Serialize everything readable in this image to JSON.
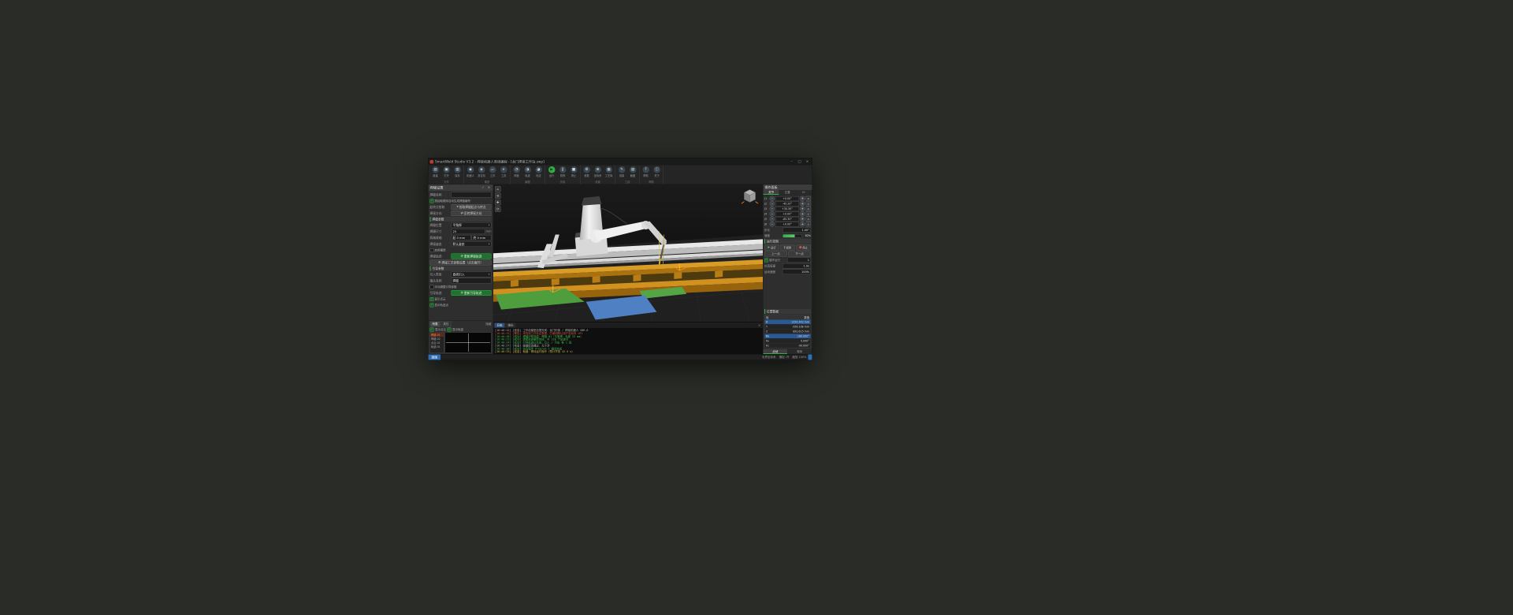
{
  "ui": {
    "chevron": "▾",
    "check": "✓"
  },
  "colors": {
    "accent_green": "#2fae44",
    "accent_blue": "#2f6fb3",
    "selection_orange": "#ff8a50",
    "log_green": "#43bf4f",
    "log_red": "#e0543f",
    "beam_orange": "#d99c26",
    "highlight_green": "#4f9e3e",
    "highlight_blue": "#5080c4",
    "table_select_blue": "#2a5a96"
  },
  "window": {
    "title": "SmartWeld Studio V3.2 - 焊接机器人离线编程 - [龙门焊接工作站.swp]",
    "minimize": "–",
    "maximize": "□",
    "close": "×"
  },
  "ribbon": {
    "groups": [
      {
        "name": "文件",
        "buttons": [
          {
            "icon": "▤",
            "label": "新建"
          },
          {
            "icon": "▣",
            "label": "打开"
          },
          {
            "icon": "▥",
            "label": "保存"
          }
        ]
      },
      {
        "name": "模型",
        "buttons": [
          {
            "icon": "◆",
            "label": "机器人"
          },
          {
            "icon": "◈",
            "label": "变位机"
          },
          {
            "icon": "▱",
            "label": "工件"
          },
          {
            "icon": "⌖",
            "label": "工具"
          }
        ]
      },
      {
        "name": "编程",
        "buttons": [
          {
            "icon": "◔",
            "label": "焊缝"
          },
          {
            "icon": "◑",
            "label": "轨迹"
          },
          {
            "icon": "◕",
            "label": "标定"
          }
        ]
      },
      {
        "name": "仿真",
        "buttons": [
          {
            "icon": "▶",
            "label": "运行",
            "style": "accent"
          },
          {
            "icon": "‖",
            "label": "暂停"
          },
          {
            "icon": "■",
            "label": "停止"
          }
        ]
      },
      {
        "name": "设置",
        "buttons": [
          {
            "icon": "⚙",
            "label": "参数"
          },
          {
            "icon": "⊞",
            "label": "坐标系"
          },
          {
            "icon": "▦",
            "label": "工艺库"
          }
        ]
      },
      {
        "name": "工具",
        "buttons": [
          {
            "icon": "✎",
            "label": "测量"
          },
          {
            "icon": "▧",
            "label": "截图"
          }
        ]
      },
      {
        "name": "帮助",
        "buttons": [
          {
            "icon": "?",
            "label": "帮助"
          },
          {
            "icon": "ⓘ",
            "label": "关于"
          }
        ]
      }
    ]
  },
  "left_panel": {
    "title": "焊缝设置",
    "confirm": "✓",
    "close": "×",
    "fields": {
      "name_label": "焊缝名称",
      "name_value": "",
      "auto_number": "按拾取顺序自动生成焊缝编号",
      "pick_label": "起终点拾取",
      "pick_icon": "⌖",
      "pick_button": "拾取焊缝起点与终点",
      "dir_label": "焊接方向",
      "dir_icon": "⇄",
      "dir_button": "反转焊接方向",
      "weld_section": "焊缝参数",
      "pos_label": "焊缝位置",
      "pos_value": "平角焊",
      "size_label": "焊脚尺寸",
      "size_value": "25",
      "size_unit": "mm",
      "shrink_label": "两端收缩",
      "shrink_start": "起 0 mm",
      "shrink_end": "终 0 mm",
      "posture_label": "焊接姿态",
      "posture_value": "默认姿态",
      "weave_check": "启用摆焊",
      "traj_label": "焊接轨迹",
      "refresh_icon": "⟳",
      "traj_button": "更新焊接轨迹",
      "process_icon": "⚙",
      "process_button": "焊接工艺参数设置（点击展开）",
      "lead_section": "引导参数",
      "lead_type_label": "引入类型",
      "lead_type_value": "直线引入",
      "head_label": "端头名称",
      "head_value": "焊缝",
      "manual_check": "手动调整引导参数",
      "lead_traj_label": "引导轨迹",
      "lead_traj_button": "更新引导轨迹",
      "show_cloud": "显示点云",
      "show_points": "显示轨迹点"
    },
    "bottom": {
      "tabs": [
        {
          "label": "列表",
          "active": "active"
        },
        {
          "label": "属性"
        }
      ],
      "hide": "隐藏",
      "check_cloud": "显示点云",
      "check_traj": "显示轨迹",
      "list": [
        {
          "label": "焊缝-01",
          "cls": "selected"
        },
        {
          "label": "焊缝-02"
        },
        {
          "label": "点云-01"
        },
        {
          "label": "轨迹-01"
        }
      ]
    }
  },
  "viewport": {
    "tools": [
      {
        "icon": "⌂",
        "name": "home"
      },
      {
        "icon": "⊕",
        "name": "zoom"
      },
      {
        "icon": "✚",
        "name": "pan"
      },
      {
        "icon": "⟳",
        "name": "rotate"
      }
    ]
  },
  "log": {
    "tabs": [
      {
        "label": "日志",
        "active": "active"
      },
      {
        "label": "输出"
      }
    ],
    "clear_icon": "×",
    "lines": [
      {
        "color": "gray",
        "text": "[16:40:12] [信息] 工作站模型加载完成：龙门桁架 / 焊接机器人 GBR-6"
      },
      {
        "color": "red",
        "text": "[16:40:15] [警告] 未找到工件标定数据，已使用默认用户坐标系 UF1"
      },
      {
        "color": "green",
        "text": "[16:40:18] [成功] 焊缝识别完成：焊缝-01（平角焊，长度 25 mm）"
      },
      {
        "color": "green",
        "text": "[16:40:21] [成功] 焊接轨迹更新完成：共 128 个轨迹点"
      },
      {
        "color": "green",
        "text": "[16:40:24] [成功] 引导轨迹已生成：引入 / 引出 各 1 段"
      },
      {
        "color": "gray",
        "text": "[16:40:27] [信息] 碰撞检测通过：无干涉"
      },
      {
        "color": "green",
        "text": "[16:40:30] [成功] 仿真程序 Program_1 编译完成"
      },
      {
        "color": "yellow",
        "text": "[16:40:33] [信息] 就绪：等待运行指令（预计节拍 42.5 s）"
      }
    ]
  },
  "right_panel": {
    "title": "操作面板",
    "tabs": [
      {
        "label": "关节",
        "active": "active"
      },
      {
        "label": "位置"
      },
      {
        "label": "IO"
      }
    ],
    "minus": "–",
    "plus": "+",
    "home_icon": "⌂",
    "jog": [
      {
        "label": "J1",
        "value": "+0.00°"
      },
      {
        "label": "J2",
        "value": "-45.20°"
      },
      {
        "label": "J3",
        "value": "+30.50°"
      },
      {
        "label": "J4",
        "value": "+0.00°"
      },
      {
        "label": "J5",
        "value": "-65.30°"
      },
      {
        "label": "J6",
        "value": "+0.00°"
      }
    ],
    "step_label": "步长",
    "step_value": "1.00°",
    "speed_label": "速度",
    "speed_value": "62%",
    "speed_width": "62%",
    "run_section": "运行控制",
    "run_buttons": [
      {
        "icon": "▶",
        "label": "运行",
        "cls": "play"
      },
      {
        "icon": "‖",
        "label": "暂停"
      },
      {
        "icon": "■",
        "label": "停止",
        "cls": "stop"
      }
    ],
    "prev_point": "上一点",
    "next_point": "下一点",
    "loop_check": "循环运行",
    "loop_value": "1",
    "sim_label": "仿真倍速",
    "sim_value": "1.0x",
    "move_label": "运动速度",
    "move_value": "100%",
    "pos_section": "位置数据",
    "points_header": {
      "name": "轴",
      "value": "数值"
    },
    "points": [
      {
        "name": "X",
        "value": "1250.342 mm",
        "cls": "selected"
      },
      {
        "name": "Y",
        "value": "-356.108 mm"
      },
      {
        "name": "Z",
        "value": "892.615 mm"
      },
      {
        "name": "Rx",
        "value": "180.000°",
        "cls": "selected"
      },
      {
        "name": "Ry",
        "value": "0.000°"
      },
      {
        "name": "Rz",
        "value": "-90.000°"
      }
    ],
    "bottom_tabs": [
      {
        "label": "点动",
        "active": "active"
      },
      {
        "label": "程序"
      }
    ]
  },
  "status_bar": {
    "ready": "就绪",
    "items": [
      {
        "text": "世界坐标系"
      },
      {
        "text": "捕捉: 开"
      },
      {
        "text": "缩放 100%"
      }
    ]
  }
}
